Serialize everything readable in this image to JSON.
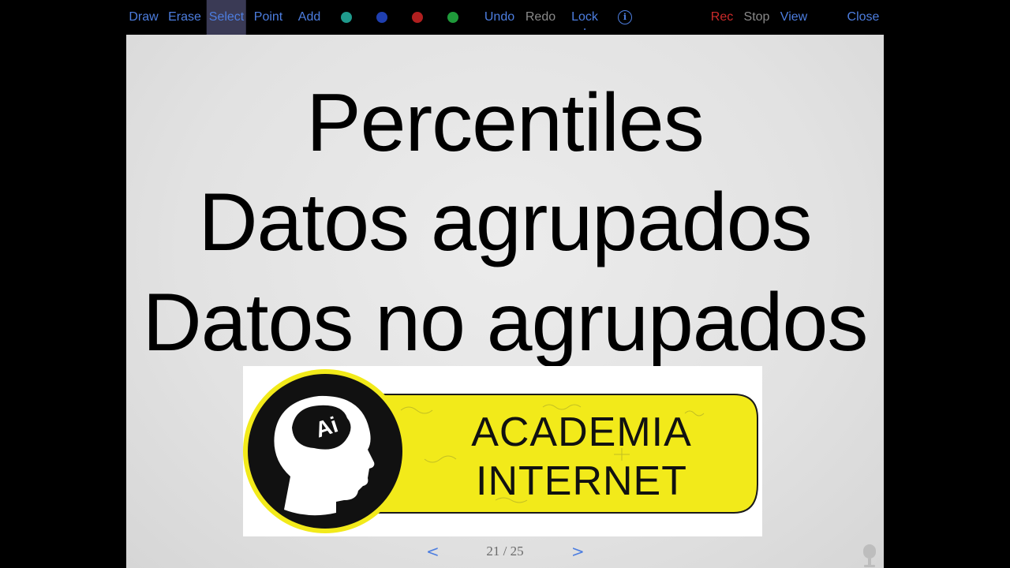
{
  "toolbar": {
    "draw": "Draw",
    "erase": "Erase",
    "select": "Select",
    "point": "Point",
    "add": "Add",
    "undo": "Undo",
    "redo": "Redo",
    "lock": "Lock",
    "info": "i",
    "rec": "Rec",
    "stop": "Stop",
    "view": "View",
    "close": "Close",
    "colors": {
      "teal": "#1f9a8c",
      "blue": "#1f3fb0",
      "red": "#b01f1f",
      "green": "#1f9a3a"
    }
  },
  "slide": {
    "line1": "Percentiles",
    "line2": "Datos agrupados",
    "line3": "Datos no agrupados",
    "logo": {
      "badge": "Ai",
      "line1": "ACADEMIA",
      "line2": "INTERNET",
      "accent_color": "#f2ea1a"
    }
  },
  "pager": {
    "prev": "<",
    "next": ">",
    "counter": "21 / 25"
  }
}
